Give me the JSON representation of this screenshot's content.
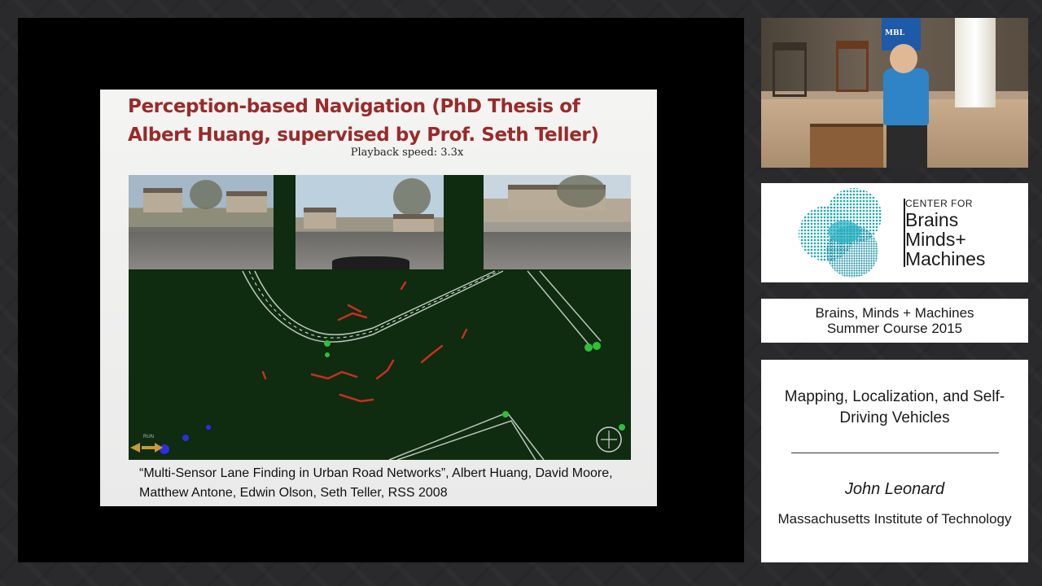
{
  "slide": {
    "title": "Perception-based Navigation (PhD Thesis of Albert Huang, supervised by Prof. Seth Teller)",
    "playback_speed": "Playback speed: 3.3x",
    "citation": "“Multi-Sensor Lane Finding in Urban Road Networks”, Albert Huang, David Moore, Matthew Antone, Edwin Olson, Seth Teller, RSS 2008",
    "viz_label": "RUN"
  },
  "speaker_video": {
    "sign_text": "MBL"
  },
  "cbmm": {
    "center_for": "CENTER FOR",
    "line1": "Brains",
    "line2": "Minds+",
    "line3": "Machines"
  },
  "course": {
    "line1": "Brains, Minds + Machines",
    "line2": "Summer Course 2015"
  },
  "talk": {
    "title": "Mapping, Localization, and Self-Driving Vehicles",
    "speaker": "John Leonard",
    "affiliation": "Massachusetts Institute of Technology"
  },
  "colors": {
    "title_red": "#9a2a2a",
    "viz_green": "#0f2b10",
    "cbmm_teal": "#1aa8b0",
    "shirt_blue": "#2f84c7"
  }
}
